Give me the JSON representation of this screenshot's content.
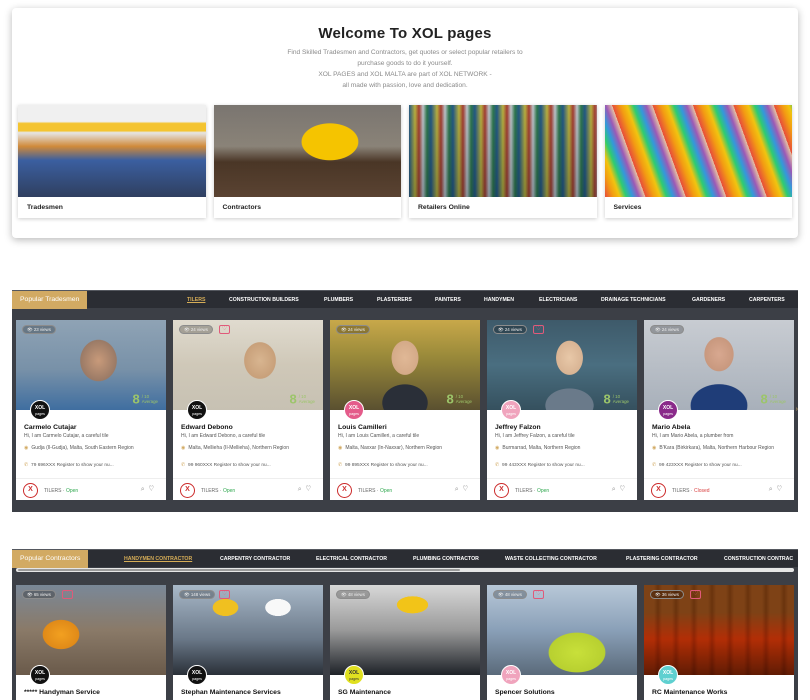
{
  "welcome": {
    "title": "Welcome To XOL pages",
    "intro": [
      "Find Skilled Tradesmen and Contractors, get quotes or select popular retailers to",
      "purchase goods to do it yourself.",
      "XOL PAGES and XOL MALTA are part of XOL NETWORK -",
      "all made with passion, love and dedication."
    ],
    "categories": [
      {
        "label": "Tradesmen"
      },
      {
        "label": "Contractors"
      },
      {
        "label": "Retailers Online"
      },
      {
        "label": "Services"
      }
    ]
  },
  "tradesmen": {
    "title": "Popular Tradesmen",
    "tabs": [
      "TILERS",
      "CONSTRUCTION BUILDERS",
      "PLUMBERS",
      "PLASTERERS",
      "PAINTERS",
      "HANDYMEN",
      "ELECTRICIANS",
      "DRAINAGE TECHNICIANS",
      "GARDENERS",
      "CARPENTERS"
    ],
    "active_tab": "TILERS",
    "cards": [
      {
        "views": "23 views",
        "score": "8",
        "of": "/ 10",
        "avg": "Average",
        "name": "Carmelo Cutajar",
        "desc": "Hi, I am Carmelo Cutajar, a careful tile",
        "loc": "Gudja (Il-Gudja), Malta, South Eastern Region",
        "phone": "79 696XXX Register to show your nu...",
        "trade": "TILERS",
        "sep": "·",
        "status": "Open",
        "logo_top": "XOL",
        "logo_bottom": "pages"
      },
      {
        "views": "24 views",
        "score": "8",
        "of": "/ 10",
        "avg": "Average",
        "name": "Edward Debono",
        "desc": "Hi, I am Edward Debono, a careful tile",
        "loc": "Malta, Mellieha (Il-Mellieha), Northern Region",
        "phone": "99 960XXX Register to show your nu...",
        "trade": "TILERS",
        "sep": "·",
        "status": "Open",
        "logo_top": "XOL",
        "logo_bottom": "pages"
      },
      {
        "views": "24 views",
        "score": "8",
        "of": "/ 10",
        "avg": "Average",
        "name": "Louis Camilleri",
        "desc": "Hi, I am Louis Camilleri, a careful tile",
        "loc": "Malta, Naxxar (In-Naxxar), Northern Region",
        "phone": "99 895XXX Register to show your nu...",
        "trade": "TILERS",
        "sep": "·",
        "status": "Open",
        "logo_top": "XOL",
        "logo_bottom": "pages"
      },
      {
        "views": "24 views",
        "score": "8",
        "of": "/ 10",
        "avg": "Average",
        "name": "Jeffrey Falzon",
        "desc": "Hi, I am Jeffrey Falzon, a careful tile",
        "loc": "Burmarrad, Malta, Northern Region",
        "phone": "99 443XXX Register to show your nu...",
        "trade": "TILERS",
        "sep": "·",
        "status": "Open",
        "logo_top": "XOL",
        "logo_bottom": "pages"
      },
      {
        "views": "24 views",
        "score": "8",
        "of": "/ 10",
        "avg": "Average",
        "name": "Mario Abela",
        "desc": "Hi, I am Mario Abela, a plumber from",
        "loc": "B'Kara (Birkirkara), Malta, Northern Harbour Region",
        "phone": "99 423XXX Register to show your nu...",
        "trade": "TILERS",
        "sep": "·",
        "status": "Closed",
        "logo_top": "XOL",
        "logo_bottom": "pages"
      }
    ]
  },
  "contractors": {
    "title": "Popular Contractors",
    "tabs": [
      "HANDYMEN CONTRACTOR",
      "CARPENTRY CONTRACTOR",
      "ELECTRICAL CONTRACTOR",
      "PLUMBING CONTRACTOR",
      "WASTE COLLECTING CONTRACTOR",
      "PLASTERING CONTRACTOR",
      "CONSTRUCTION CONTRAC"
    ],
    "active_tab": "HANDYMEN CONTRACTOR",
    "cards": [
      {
        "views": "65 views",
        "name": "***** Handyman Service",
        "logo_top": "XOL",
        "logo_bottom": "pages"
      },
      {
        "views": "148 views",
        "name": "Stephan Maintenance Services",
        "logo_top": "XOL",
        "logo_bottom": "pages"
      },
      {
        "views": "48 views",
        "name": "SG Maintenance",
        "logo_top": "XOL",
        "logo_bottom": "pages"
      },
      {
        "views": "48 views",
        "name": "Spencer Solutions",
        "logo_top": "XOL",
        "logo_bottom": "pages"
      },
      {
        "views": "36 views",
        "name": "RC Maintenance Works",
        "logo_top": "XOL",
        "logo_bottom": "pages"
      }
    ]
  },
  "icons": {
    "eye": "eye-icon",
    "heart": "heart-icon",
    "pin": "map-pin-icon",
    "phone": "phone-icon",
    "search": "search-icon",
    "chevron": "chevron-right-icon"
  },
  "colors": {
    "accent": "#d2aa63",
    "dark": "#2b2d33",
    "panel": "#3c3f46",
    "open": "#2fa84f",
    "closed": "#d94040",
    "rating": "#9cc56a",
    "badge": "#cc2b2b"
  }
}
